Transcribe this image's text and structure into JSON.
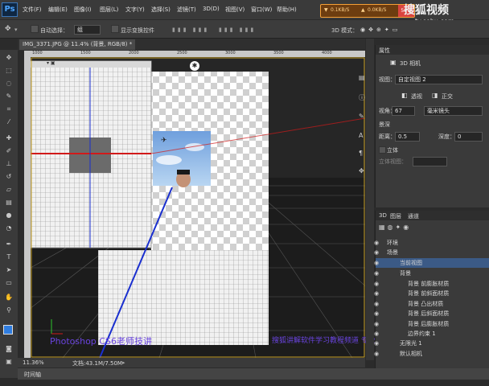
{
  "app": {
    "logo": "Ps"
  },
  "menu": [
    "文件(F)",
    "编辑(E)",
    "图像(I)",
    "图层(L)",
    "文字(Y)",
    "选择(S)",
    "滤镜(T)",
    "3D(D)",
    "视图(V)",
    "窗口(W)",
    "帮助(H)"
  ],
  "network": {
    "down": "0.1KB/S",
    "up": "0.0KB/S",
    "pct": "58%"
  },
  "watermark": {
    "logo": "搜狐视频",
    "url": "tv.sohu.com"
  },
  "options": {
    "auto_select": "自动选择：",
    "auto_select_value": "组",
    "transform": "显示变换控件",
    "mode3d": "3D 模式："
  },
  "document": {
    "tab": "IMG_3371.JPG @ 11.4% (背景, RGB/8) *"
  },
  "ruler": [
    "1000",
    "1500",
    "2000",
    "2500",
    "3000",
    "3500",
    "4000"
  ],
  "status": {
    "zoom": "11.36%",
    "doc": "文档:43.1M/7.50M"
  },
  "timeline": {
    "label": "时间轴"
  },
  "overlay": {
    "left": "Photoshop CS6老师技讲",
    "right": "搜狐讲解软件学习教程频道 专业教程"
  },
  "properties": {
    "tab": "属性",
    "title": "3D 相机",
    "view_label": "视图：",
    "view_value": "自定视图 2",
    "perspective": "透视",
    "ortho": "正交",
    "fov_label": "视角：",
    "fov_value": "67",
    "lens_value": "毫米镜头",
    "dof": "景深",
    "distance_label": "距离：",
    "distance_value": "0.5",
    "depth_label": "深度：",
    "depth_value": "0",
    "stereo": "立体",
    "stereo_view": "立体视图："
  },
  "panel3d": {
    "tabs": [
      "3D",
      "图层",
      "通道"
    ],
    "layers": [
      {
        "label": "环境",
        "indent": 0
      },
      {
        "label": "场景",
        "indent": 0
      },
      {
        "label": "当前视图",
        "indent": 1,
        "selected": true
      },
      {
        "label": "背景",
        "indent": 1
      },
      {
        "label": "背景 前膨胀材质",
        "indent": 2
      },
      {
        "label": "背景 前斜面材质",
        "indent": 2
      },
      {
        "label": "背景 凸出材质",
        "indent": 2
      },
      {
        "label": "背景 后斜面材质",
        "indent": 2
      },
      {
        "label": "背景 后膨胀材质",
        "indent": 2
      },
      {
        "label": "边界约束 1",
        "indent": 2
      },
      {
        "label": "无限光 1",
        "indent": 1
      },
      {
        "label": "默认相机",
        "indent": 1
      }
    ]
  },
  "colors": {
    "accent": "#2f7de0",
    "red_axis": "#d11a1a",
    "blue_axis": "#1a2fcf"
  }
}
